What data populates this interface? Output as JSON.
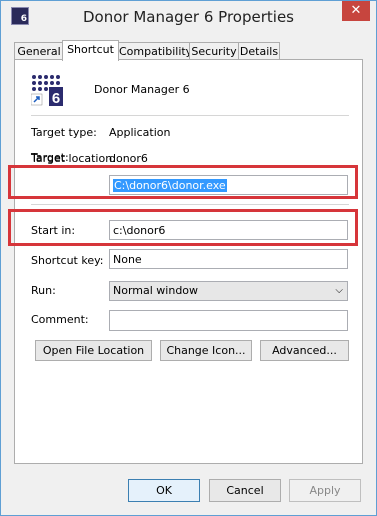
{
  "window": {
    "title": "Donor Manager 6 Properties",
    "close_glyph": "✕",
    "icon_text": "6"
  },
  "tabs": [
    {
      "label": "General"
    },
    {
      "label": "Shortcut"
    },
    {
      "label": "Compatibility"
    },
    {
      "label": "Security"
    },
    {
      "label": "Details"
    }
  ],
  "shortcut": {
    "app_name": "Donor Manager 6",
    "target_type_label": "Target type:",
    "target_type_value": "Application",
    "target_location_label": "Target location:",
    "target_location_value": "donor6",
    "target_label": "Target:",
    "target_value": "C:\\donor6\\donor.exe",
    "start_in_label": "Start in:",
    "start_in_value": "c:\\donor6",
    "shortcut_key_label": "Shortcut key:",
    "shortcut_key_value": "None",
    "run_label": "Run:",
    "run_value": "Normal window",
    "comment_label": "Comment:",
    "comment_value": "",
    "open_file_location": "Open File Location",
    "change_icon": "Change Icon...",
    "advanced": "Advanced..."
  },
  "footer": {
    "ok": "OK",
    "cancel": "Cancel",
    "apply": "Apply"
  },
  "colors": {
    "highlight_box": "#d6353a",
    "selection": "#3399ff"
  }
}
